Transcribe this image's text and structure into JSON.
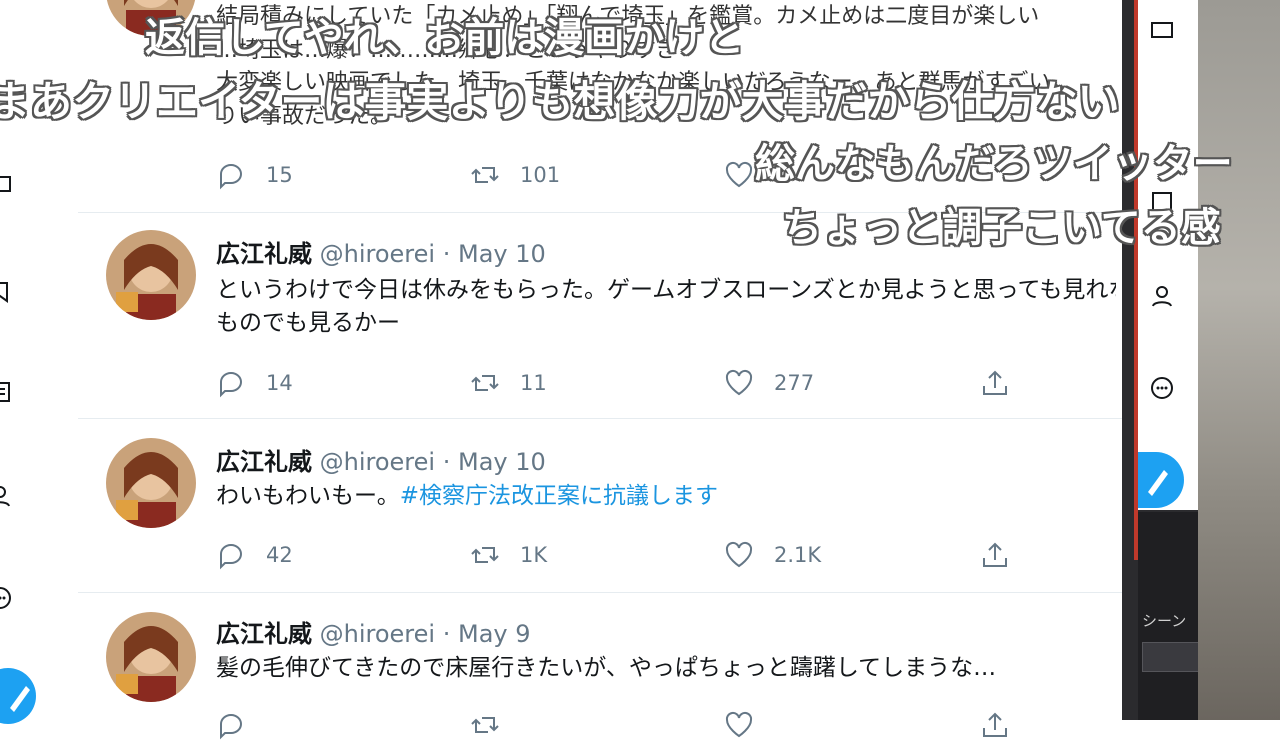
{
  "timeline": {
    "partial_top_tweet": {
      "text_lines": [
        "結局積みにしていた「カメ止め」「翔んで埼玉」を鑑賞。カメ止めは二度目が楽しい",
        "…埼玉は…爆！…………郷心！というやりすぎ",
        "大変楽しい映画でした。埼玉、千葉はなかなか楽しいだろうなー。あと群馬がすごい",
        "りい事故だった。"
      ],
      "replies": "15",
      "retweets": "101",
      "likes": ""
    },
    "tweets": [
      {
        "name": "広江礼威",
        "handle": "@hiroerei",
        "date": "May 10",
        "text_lines": [
          "というわけで今日は休みをもらった。ゲームオブスローンズとか見ようと思っても見れなか",
          "ものでも見るかー"
        ],
        "hashtag": "",
        "replies": "14",
        "retweets": "11",
        "likes": "277"
      },
      {
        "name": "広江礼威",
        "handle": "@hiroerei",
        "date": "May 10",
        "text_lines": [
          "わいもわいもー。"
        ],
        "hashtag": "#検察庁法改正案に抗議します",
        "replies": "42",
        "retweets": "1K",
        "likes": "2.1K"
      },
      {
        "name": "広江礼威",
        "handle": "@hiroerei",
        "date": "May 9",
        "text_lines": [
          "髪の毛伸びてきたので床屋行きたいが、やっぱちょっと躊躇してしまうな…"
        ],
        "hashtag": "",
        "replies": "",
        "retweets": "",
        "likes": ""
      }
    ],
    "separator": "·"
  },
  "comments": [
    "返信してやれ、お前は漫画かけと",
    "まあクリエイターは事実よりも想像力が大事だから仕方ない",
    "総んなもんだろツイッター",
    "ちょっと調子こいてる感"
  ],
  "right_panel": {
    "scene_label": "シーン"
  },
  "colors": {
    "twitter_blue": "#1da1f2",
    "hashtag": "#1b95e0",
    "meta_gray": "#657786"
  },
  "icons": [
    "reply-icon",
    "retweet-icon",
    "like-icon",
    "share-icon",
    "compose-icon"
  ]
}
